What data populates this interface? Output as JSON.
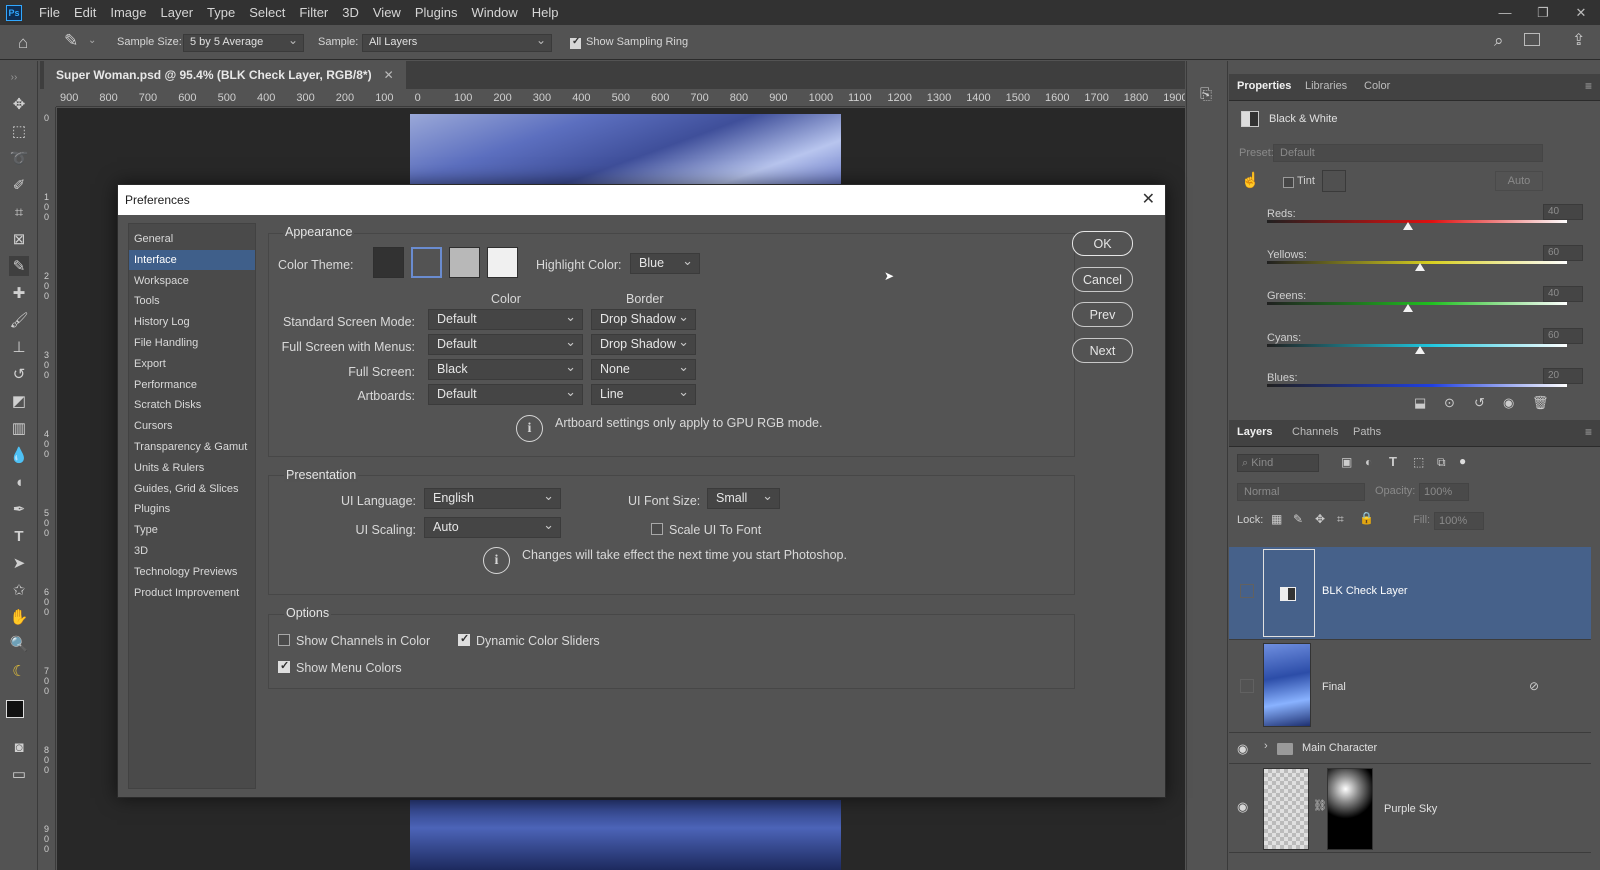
{
  "menubar": {
    "logo": "Ps",
    "items": [
      "File",
      "Edit",
      "Image",
      "Layer",
      "Type",
      "Select",
      "Filter",
      "3D",
      "View",
      "Plugins",
      "Window",
      "Help"
    ]
  },
  "options": {
    "sample_size_label": "Sample Size:",
    "sample_size_value": "5 by 5 Average",
    "sample_label": "Sample:",
    "sample_value": "All Layers",
    "show_ring_label": "Show Sampling Ring",
    "show_ring_checked": true
  },
  "document": {
    "tab_title": "Super Woman.psd @ 95.4% (BLK Check Layer, RGB/8*)",
    "ruler_h": [
      "900",
      "800",
      "700",
      "600",
      "500",
      "400",
      "300",
      "200",
      "100",
      "0",
      "100",
      "200",
      "300",
      "400",
      "500",
      "600",
      "700",
      "800",
      "900",
      "1000",
      "1100",
      "1200",
      "1300",
      "1400",
      "1500",
      "1600",
      "1700",
      "1800",
      "1900"
    ],
    "ruler_v": [
      "0",
      "100",
      "200",
      "300",
      "400",
      "500",
      "600",
      "700",
      "800",
      "900"
    ]
  },
  "properties": {
    "tabs": [
      "Properties",
      "Libraries",
      "Color"
    ],
    "adjustment_name": "Black & White",
    "preset_label": "Preset:",
    "preset_value": "Default",
    "tint_label": "Tint",
    "auto_label": "Auto",
    "sliders": [
      {
        "label": "Reds:",
        "value": "40",
        "level": 0.47
      },
      {
        "label": "Yellows:",
        "value": "60",
        "level": 0.51
      },
      {
        "label": "Greens:",
        "value": "40",
        "level": 0.47
      },
      {
        "label": "Cyans:",
        "value": "60",
        "level": 0.51
      },
      {
        "label": "Blues:",
        "value": "20",
        "level": 0.4
      }
    ]
  },
  "layers": {
    "tabs": [
      "Layers",
      "Channels",
      "Paths"
    ],
    "kind_label": "Kind",
    "blend_mode": "Normal",
    "opacity_label": "Opacity:",
    "opacity_value": "100%",
    "lock_label": "Lock:",
    "fill_label": "Fill:",
    "fill_value": "100%",
    "items": [
      {
        "name": "BLK Check Layer",
        "selected": true
      },
      {
        "name": "Final",
        "selected": false
      },
      {
        "name": "Main Character",
        "group": true
      },
      {
        "name": "Purple Sky",
        "selected": false
      }
    ]
  },
  "dialog": {
    "title": "Preferences",
    "categories": [
      "General",
      "Interface",
      "Workspace",
      "Tools",
      "History Log",
      "File Handling",
      "Export",
      "Performance",
      "Scratch Disks",
      "Cursors",
      "Transparency & Gamut",
      "Units & Rulers",
      "Guides, Grid & Slices",
      "Plugins",
      "Type",
      "3D",
      "Technology Previews",
      "Product Improvement"
    ],
    "selected_category": "Interface",
    "buttons": {
      "ok": "OK",
      "cancel": "Cancel",
      "prev": "Prev",
      "next": "Next"
    },
    "appearance": {
      "title": "Appearance",
      "color_theme_label": "Color Theme:",
      "theme_colors": [
        "#323232",
        "#535353",
        "#b8b8b8",
        "#f0f0f0"
      ],
      "highlight_label": "Highlight Color:",
      "highlight_value": "Blue",
      "col_color": "Color",
      "col_border": "Border",
      "rows": [
        {
          "label": "Standard Screen Mode:",
          "color": "Default",
          "border": "Drop Shadow"
        },
        {
          "label": "Full Screen with Menus:",
          "color": "Default",
          "border": "Drop Shadow"
        },
        {
          "label": "Full Screen:",
          "color": "Black",
          "border": "None"
        },
        {
          "label": "Artboards:",
          "color": "Default",
          "border": "Line"
        }
      ],
      "note": "Artboard settings only apply to GPU RGB mode."
    },
    "presentation": {
      "title": "Presentation",
      "ui_language_label": "UI Language:",
      "ui_language_value": "English",
      "ui_font_size_label": "UI Font Size:",
      "ui_font_size_value": "Small",
      "ui_scaling_label": "UI Scaling:",
      "ui_scaling_value": "Auto",
      "scale_ui_label": "Scale UI To Font",
      "scale_ui_checked": false,
      "note": "Changes will take effect the next time you start Photoshop."
    },
    "options": {
      "title": "Options",
      "show_channels_label": "Show Channels in Color",
      "show_channels_checked": false,
      "dynamic_sliders_label": "Dynamic Color Sliders",
      "dynamic_sliders_checked": true,
      "show_menu_colors_label": "Show Menu Colors",
      "show_menu_colors_checked": true
    }
  },
  "colors": {
    "accent": "#3f5f8a",
    "panel_bg": "#535353",
    "menubar_bg": "#323232"
  }
}
